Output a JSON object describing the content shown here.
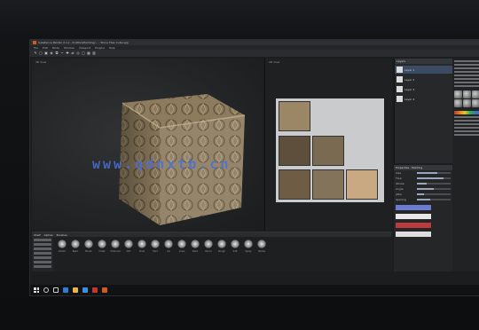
{
  "window": {
    "title": "Substance Painter 2.x.x - D:/Work/Painting/... - Stone Tiles Cube.spp"
  },
  "menu": {
    "items": [
      "File",
      "Edit",
      "Mode",
      "Window",
      "Viewport",
      "Plugins",
      "Help"
    ]
  },
  "viewports": {
    "left_label": "3D View",
    "right_label": "2D View"
  },
  "watermark": "www.qdnxtb.cn",
  "layers": {
    "header": "Layers",
    "rows": [
      "Layer 1",
      "Layer 2",
      "Layer 3",
      "Layer 4"
    ]
  },
  "properties": {
    "header": "Properties - Painting",
    "rows": [
      "Size",
      "Flow",
      "Stroke",
      "Angle",
      "Jitter",
      "Spacing"
    ],
    "fills": [
      0.6,
      0.8,
      0.3,
      0.5,
      0.2,
      0.4
    ]
  },
  "shelf": {
    "title": "Shelf",
    "tabs": [
      "Alphas",
      "Brushes"
    ],
    "brushes": [
      "Artistic",
      "Basic",
      "Brush",
      "Chalk",
      "Charcoal",
      "Dirt",
      "Dust",
      "Hard",
      "Ink",
      "Lines",
      "Paint",
      "Pencil",
      "Rough",
      "Soft",
      "Spray",
      "Stroke"
    ]
  },
  "colors": {
    "accent": "#d35a1d",
    "selection": "#3b4b63",
    "watermark": "#4a6fd8"
  }
}
